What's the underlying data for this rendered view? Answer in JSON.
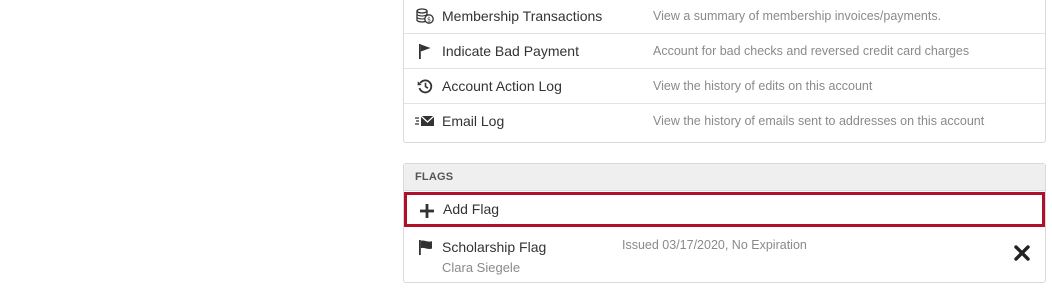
{
  "account_actions": [
    {
      "icon": "coins-icon",
      "label": "Membership Transactions",
      "description": "View a summary of membership invoices/payments."
    },
    {
      "icon": "flag-icon",
      "label": "Indicate Bad Payment",
      "description": "Account for bad checks and reversed credit card charges"
    },
    {
      "icon": "history-icon",
      "label": "Account Action Log",
      "description": "View the history of edits on this account"
    },
    {
      "icon": "email-icon",
      "label": "Email Log",
      "description": "View the history of emails sent to addresses on this account"
    }
  ],
  "flags": {
    "header": "FLAGS",
    "add_label": "Add Flag",
    "highlight_color": "#b0102a",
    "items": [
      {
        "name": "Scholarship Flag",
        "person": "Clara Siegele",
        "issued": "Issued 03/17/2020, No Expiration"
      }
    ]
  }
}
